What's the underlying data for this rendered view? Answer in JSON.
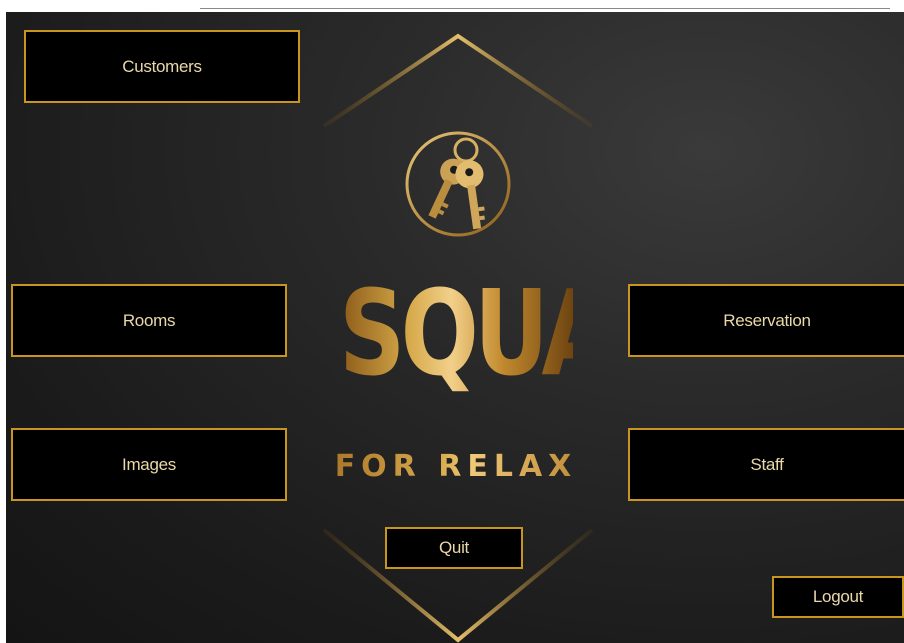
{
  "menu": {
    "customers_label": "Customers",
    "rooms_label": "Rooms",
    "images_label": "Images",
    "reservation_label": "Reservation",
    "staff_label": "Staff",
    "quit_label": "Quit",
    "logout_label": "Logout"
  },
  "logo": {
    "title": "SQUAD",
    "subtitle": "FOR RELAX",
    "icon": "keys-icon"
  },
  "colors": {
    "accent_gold": "#c8961e",
    "button_bg": "#000000",
    "button_text": "#e9d8a8",
    "panel_bg": "#1b1b1b"
  }
}
